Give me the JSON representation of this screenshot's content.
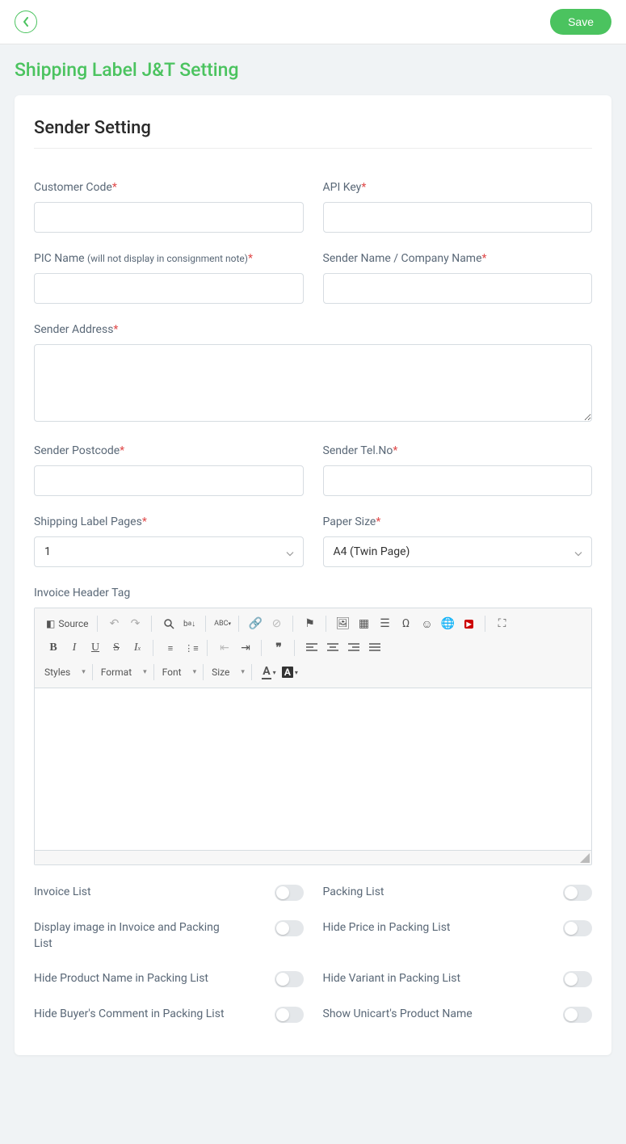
{
  "topbar": {
    "save_label": "Save"
  },
  "page_title": "Shipping Label J&T Setting",
  "section_title": "Sender Setting",
  "fields": {
    "customer_code": {
      "label": "Customer Code",
      "required": true,
      "value": ""
    },
    "api_key": {
      "label": "API Key",
      "required": true,
      "value": ""
    },
    "pic_name": {
      "label": "PIC Name ",
      "sub": "(will not display in consignment note)",
      "required": true,
      "value": ""
    },
    "sender_name": {
      "label": "Sender Name / Company Name",
      "required": true,
      "value": ""
    },
    "sender_address": {
      "label": "Sender Address",
      "required": true,
      "value": ""
    },
    "sender_postcode": {
      "label": "Sender Postcode",
      "required": true,
      "value": ""
    },
    "sender_tel": {
      "label": "Sender Tel.No",
      "required": true,
      "value": ""
    },
    "shipping_pages": {
      "label": "Shipping Label Pages",
      "required": true,
      "value": "1"
    },
    "paper_size": {
      "label": "Paper Size",
      "required": true,
      "value": "A4 (Twin Page)"
    },
    "invoice_header": {
      "label": "Invoice Header Tag"
    }
  },
  "editor": {
    "source_label": "Source",
    "style_selects": {
      "styles": "Styles",
      "format": "Format",
      "font": "Font",
      "size": "Size"
    }
  },
  "toggles": {
    "invoice_list": {
      "label": "Invoice List",
      "value": false
    },
    "packing_list": {
      "label": "Packing List",
      "value": false
    },
    "display_image": {
      "label": "Display image in Invoice and Packing List",
      "value": false
    },
    "hide_price": {
      "label": "Hide Price in Packing List",
      "value": false
    },
    "hide_product_name": {
      "label": "Hide Product Name in Packing List",
      "value": false
    },
    "hide_variant": {
      "label": "Hide Variant in Packing List",
      "value": false
    },
    "hide_buyer_comment": {
      "label": "Hide Buyer's Comment in Packing List",
      "value": false
    },
    "show_unicart_name": {
      "label": "Show Unicart's Product Name",
      "value": false
    }
  }
}
